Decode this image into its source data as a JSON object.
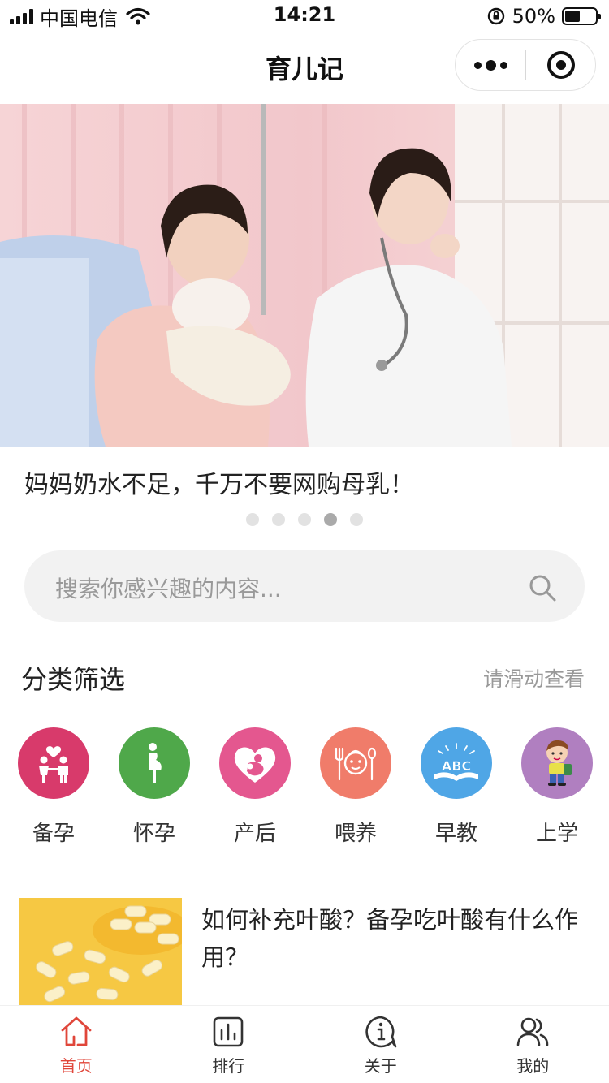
{
  "status_bar": {
    "carrier": "中国电信",
    "time": "14:21",
    "battery": "50%",
    "battery_level": 0.5
  },
  "nav": {
    "title": "育儿记"
  },
  "banner": {
    "caption": "妈妈奶水不足，千万不要网购母乳！",
    "slide_count": 5,
    "active_index": 3
  },
  "search": {
    "placeholder": "搜索你感兴趣的内容..."
  },
  "categories": {
    "title": "分类筛选",
    "hint": "请滑动查看",
    "items": [
      {
        "label": "备孕",
        "icon": "couple-heart-icon",
        "color": "#d83a6b"
      },
      {
        "label": "怀孕",
        "icon": "pregnant-woman-icon",
        "color": "#4fa84a"
      },
      {
        "label": "产后",
        "icon": "mother-baby-heart-icon",
        "color": "#e4578f"
      },
      {
        "label": "喂养",
        "icon": "baby-food-icon",
        "color": "#f07c6a"
      },
      {
        "label": "早教",
        "icon": "abc-book-icon",
        "color": "#4fa6e6"
      },
      {
        "label": "上学",
        "icon": "schoolboy-icon",
        "color": "#b07fc0"
      }
    ]
  },
  "articles": [
    {
      "title": "如何补充叶酸？备孕吃叶酸有什么作用？",
      "thumb_icon": "folic-acid-pills-image"
    }
  ],
  "tabs": [
    {
      "label": "首页",
      "icon": "home-icon",
      "active": true
    },
    {
      "label": "排行",
      "icon": "ranking-chart-icon",
      "active": false
    },
    {
      "label": "关于",
      "icon": "info-bubble-icon",
      "active": false
    },
    {
      "label": "我的",
      "icon": "users-icon",
      "active": false
    }
  ],
  "colors": {
    "accent": "#e0463a",
    "tab_inactive": "#333333",
    "hint_text": "#999999"
  }
}
